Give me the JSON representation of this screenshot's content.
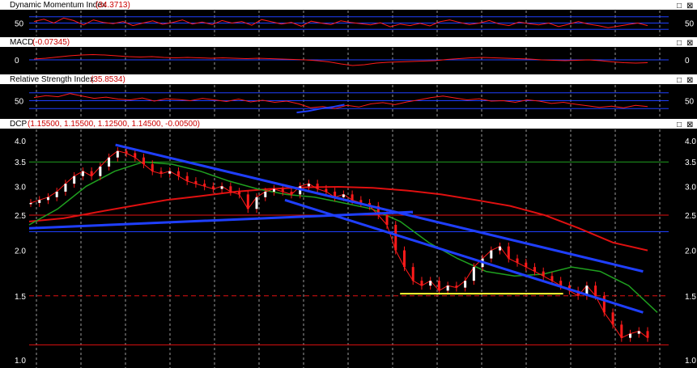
{
  "panels": [
    {
      "id": "dmi",
      "title": "Dynamic Momentum Index",
      "value": "(34.3713)",
      "buttons": [
        "□",
        "⊠"
      ],
      "y_ticks": [
        "50"
      ]
    },
    {
      "id": "macd",
      "title": "MACD",
      "value": "(-0.07345)",
      "buttons": [
        "□",
        "⊠"
      ],
      "y_ticks": [
        "0"
      ]
    },
    {
      "id": "rsi",
      "title": "Relative Strength Index",
      "value": "(35.8534)",
      "buttons": [
        "□",
        "⊠"
      ],
      "y_ticks": [
        "50"
      ]
    },
    {
      "id": "price",
      "title": "DCP",
      "value": "(1.15500, 1.15500, 1.12500, 1.14500, -0.00500)",
      "buttons": [
        "□",
        "⊠"
      ],
      "y_ticks": [
        "4.0",
        "3.5",
        "3.0",
        "2.5",
        "2.0",
        "1.5",
        "1.0"
      ]
    }
  ],
  "colors": {
    "background": "#000000",
    "header": "#ffffff",
    "header_text": "#000000",
    "header_value": "#cc0000",
    "axis_text": "#ffffff",
    "grid": "#9a9a9a",
    "price_line": "#ff1a1a",
    "indicator_line": "#ff1a1a",
    "blue_line": "#1f3fff",
    "green_line": "#1fa01f",
    "red_ma": "#e01010",
    "yellow_support": "#ffff33"
  },
  "chart_data": [
    {
      "type": "line",
      "panel": "dmi",
      "y_scale": "linear",
      "ylim": [
        10,
        90
      ],
      "reference_lines": [
        30,
        50,
        70
      ],
      "series": [
        {
          "values": [
            55,
            62,
            50,
            66,
            58,
            44,
            60,
            52,
            48,
            55,
            42,
            50,
            57,
            46,
            52,
            60,
            47,
            53,
            45,
            58,
            50,
            55,
            43,
            61,
            54,
            47,
            52,
            40,
            56,
            50,
            45,
            57,
            52,
            48,
            44,
            51,
            38,
            47,
            42,
            49,
            41,
            54,
            60,
            52,
            45,
            50,
            58,
            47,
            42,
            53,
            48,
            44,
            50,
            39,
            46,
            55,
            47,
            42,
            35,
            40,
            45,
            50,
            42
          ]
        }
      ]
    },
    {
      "type": "line",
      "panel": "macd",
      "y_scale": "linear",
      "ylim": [
        -0.3,
        0.3
      ],
      "reference_lines": [
        0
      ],
      "series": [
        {
          "values": [
            0.02,
            0.04,
            0.07,
            0.1,
            0.12,
            0.13,
            0.12,
            0.1,
            0.08,
            0.07,
            0.08,
            0.06,
            0.05,
            0.06,
            0.05,
            0.04,
            0.05,
            0.04,
            0.03,
            0.04,
            0.03,
            0.02,
            0.01,
            0.0,
            -0.02,
            -0.05,
            -0.1,
            -0.14,
            -0.12,
            -0.08,
            -0.06,
            -0.05,
            -0.04,
            -0.03,
            -0.02,
            0.01,
            0.03,
            0.05,
            0.06,
            0.05,
            0.04,
            0.03,
            0.02,
            0.0,
            -0.01,
            -0.02,
            -0.01,
            0.0,
            -0.02,
            -0.05,
            -0.07,
            -0.08,
            -0.07
          ]
        }
      ]
    },
    {
      "type": "line",
      "panel": "rsi",
      "y_scale": "linear",
      "ylim": [
        10,
        90
      ],
      "reference_lines": [
        30,
        50,
        70
      ],
      "series": [
        {
          "values": [
            58,
            63,
            60,
            68,
            62,
            56,
            59,
            54,
            52,
            57,
            49,
            55,
            53,
            50,
            56,
            52,
            48,
            54,
            47,
            51,
            46,
            49,
            42,
            32,
            35,
            30,
            38,
            34,
            42,
            45,
            40,
            47,
            52,
            58,
            62,
            57,
            52,
            55,
            49,
            50,
            46,
            52,
            49,
            43,
            46,
            41,
            37,
            33,
            36,
            32,
            38,
            35
          ]
        },
        {
          "values": [
            null,
            null,
            null,
            null,
            null,
            null,
            null,
            null,
            null,
            null,
            null,
            null,
            null,
            null,
            null,
            null,
            null,
            null,
            null,
            null,
            null,
            null,
            20,
            24,
            30,
            34,
            40
          ]
        }
      ]
    },
    {
      "type": "candlestick",
      "panel": "price",
      "y_scale": "log",
      "ylim": [
        0.95,
        4.3
      ],
      "close_series": [
        2.7,
        2.75,
        2.8,
        2.9,
        3.05,
        3.2,
        3.3,
        3.2,
        3.4,
        3.6,
        3.75,
        3.7,
        3.6,
        3.45,
        3.3,
        3.25,
        3.3,
        3.2,
        3.1,
        3.05,
        3.0,
        2.95,
        3.0,
        2.9,
        2.85,
        2.6,
        2.8,
        2.9,
        2.95,
        2.9,
        2.85,
        3.0,
        3.05,
        2.95,
        2.9,
        2.8,
        2.85,
        2.75,
        2.7,
        2.65,
        2.5,
        2.35,
        2.0,
        1.8,
        1.65,
        1.6,
        1.65,
        1.55,
        1.6,
        1.58,
        1.65,
        1.8,
        1.9,
        2.0,
        2.05,
        1.9,
        1.85,
        1.8,
        1.75,
        1.7,
        1.65,
        1.6,
        1.55,
        1.5,
        1.6,
        1.5,
        1.35,
        1.25,
        1.15,
        1.18,
        1.2,
        1.15
      ],
      "reference_lines": [
        {
          "value": 3.5,
          "color": "green"
        },
        {
          "value": 2.5,
          "color": "red"
        },
        {
          "value": 2.25,
          "color": "blue"
        },
        {
          "value": 1.5,
          "color": "red",
          "style": "dashed"
        },
        {
          "value": 1.1,
          "color": "red"
        }
      ],
      "moving_average_red": [
        2.4,
        2.45,
        2.55,
        2.65,
        2.75,
        2.82,
        2.9,
        2.95,
        2.98,
        2.99,
        2.97,
        2.92,
        2.85,
        2.75,
        2.65,
        2.5,
        2.3,
        2.1,
        2.0
      ],
      "moving_average_green": [
        2.35,
        2.6,
        3.0,
        3.3,
        3.5,
        3.45,
        3.3,
        3.1,
        2.95,
        2.85,
        2.8,
        2.7,
        2.6,
        2.4,
        2.1,
        1.9,
        1.75,
        1.7,
        1.72,
        1.8,
        1.75,
        1.6,
        1.35
      ],
      "trendlines": [
        {
          "color": "blue",
          "from": [
            0.135,
            3.9
          ],
          "to": [
            0.96,
            1.75
          ]
        },
        {
          "color": "blue",
          "from": [
            0.0,
            2.3
          ],
          "to": [
            0.6,
            2.55
          ]
        },
        {
          "color": "blue",
          "from": [
            0.4,
            2.75
          ],
          "to": [
            0.96,
            1.35
          ]
        },
        {
          "color": "yellow",
          "from": [
            0.58,
            1.52
          ],
          "to": [
            0.835,
            1.52
          ]
        }
      ]
    }
  ]
}
